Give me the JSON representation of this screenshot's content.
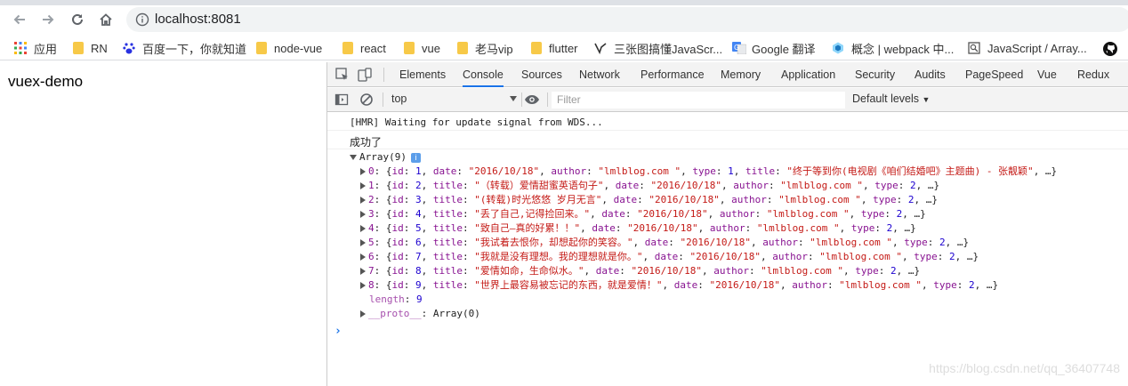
{
  "browser": {
    "url": "localhost:8081"
  },
  "bookmarks": [
    {
      "label": "应用",
      "icon": "apps-grid-icon"
    },
    {
      "label": "RN",
      "icon": "folder-icon"
    },
    {
      "label": "百度一下，你就知道",
      "icon": "baidu-paw-icon"
    },
    {
      "label": "node-vue",
      "icon": "folder-icon"
    },
    {
      "label": "react",
      "icon": "folder-icon"
    },
    {
      "label": "vue",
      "icon": "folder-icon"
    },
    {
      "label": "老马vip",
      "icon": "folder-icon"
    },
    {
      "label": "flutter",
      "icon": "folder-icon"
    },
    {
      "label": "三张图搞懂JavaScr...",
      "icon": "link-favicon-icon"
    },
    {
      "label": "Google 翻译",
      "icon": "google-translate-icon"
    },
    {
      "label": "概念 | webpack 中...",
      "icon": "webpack-icon"
    },
    {
      "label": "JavaScript / Array...",
      "icon": "page-icon"
    },
    {
      "label": "",
      "icon": "github-icon"
    }
  ],
  "page": {
    "title": "vuex-demo"
  },
  "devtools": {
    "tabs": [
      "Elements",
      "Console",
      "Sources",
      "Network",
      "Performance",
      "Memory",
      "Application",
      "Security",
      "Audits",
      "PageSpeed",
      "Vue",
      "Redux"
    ],
    "active_tab": "Console",
    "context": "top",
    "filter_placeholder": "Filter",
    "levels": "Default levels"
  },
  "console": {
    "hmr": "[HMR] Waiting for update signal from WDS...",
    "success": "成功了",
    "array_header": "Array(9)",
    "items": [
      {
        "idx": "0",
        "id": "1",
        "first_key": "date",
        "first_val": "\"2016/10/18\"",
        "second_key": "author",
        "second_val": "\"lmlblog.com \"",
        "third_key": "type",
        "third_val": "1",
        "fourth_key": "title",
        "fourth_val": "\"终于等到你(电视剧《咱们结婚吧》主题曲) - 张靓颖\"",
        "tail": ", …}"
      },
      {
        "idx": "1",
        "id": "2",
        "first_key": "title",
        "first_val": "\"（转载）爱情甜蜜英语句子\"",
        "second_key": "date",
        "second_val": "\"2016/10/18\"",
        "third_key": "author",
        "third_val": "\"lmlblog.com \"",
        "fourth_key": "type",
        "fourth_val": "2",
        "tail": ", …}"
      },
      {
        "idx": "2",
        "id": "3",
        "first_key": "title",
        "first_val": "\"(转载)时光悠悠 岁月无言\"",
        "second_key": "date",
        "second_val": "\"2016/10/18\"",
        "third_key": "author",
        "third_val": "\"lmlblog.com \"",
        "fourth_key": "type",
        "fourth_val": "2",
        "tail": ", …}"
      },
      {
        "idx": "3",
        "id": "4",
        "first_key": "title",
        "first_val": "\"丢了自己,记得捡回来。\"",
        "second_key": "date",
        "second_val": "\"2016/10/18\"",
        "third_key": "author",
        "third_val": "\"lmlblog.com \"",
        "fourth_key": "type",
        "fourth_val": "2",
        "tail": ", …}"
      },
      {
        "idx": "4",
        "id": "5",
        "first_key": "title",
        "first_val": "\"致自己—真的好累！！\"",
        "second_key": "date",
        "second_val": "\"2016/10/18\"",
        "third_key": "author",
        "third_val": "\"lmlblog.com \"",
        "fourth_key": "type",
        "fourth_val": "2",
        "tail": ", …}"
      },
      {
        "idx": "5",
        "id": "6",
        "first_key": "title",
        "first_val": "\"我试着去恨你，却想起你的笑容。\"",
        "second_key": "date",
        "second_val": "\"2016/10/18\"",
        "third_key": "author",
        "third_val": "\"lmlblog.com \"",
        "fourth_key": "type",
        "fourth_val": "2",
        "tail": ", …}"
      },
      {
        "idx": "6",
        "id": "7",
        "first_key": "title",
        "first_val": "\"我就是没有理想。我的理想就是你。\"",
        "second_key": "date",
        "second_val": "\"2016/10/18\"",
        "third_key": "author",
        "third_val": "\"lmlblog.com \"",
        "fourth_key": "type",
        "fourth_val": "2",
        "tail": ", …}"
      },
      {
        "idx": "7",
        "id": "8",
        "first_key": "title",
        "first_val": "\"爱情如命，生命似水。\"",
        "second_key": "date",
        "second_val": "\"2016/10/18\"",
        "third_key": "author",
        "third_val": "\"lmlblog.com \"",
        "fourth_key": "type",
        "fourth_val": "2",
        "tail": ", …}"
      },
      {
        "idx": "8",
        "id": "9",
        "first_key": "title",
        "first_val": "\"世界上最容易被忘记的东西，就是爱情！\"",
        "second_key": "date",
        "second_val": "\"2016/10/18\"",
        "third_key": "author",
        "third_val": "\"lmlblog.com \"",
        "fourth_key": "type",
        "fourth_val": "2",
        "tail": ", …}"
      }
    ],
    "length_key": "length",
    "length_val": "9",
    "proto_key": "__proto__",
    "proto_val": "Array(0)"
  },
  "watermark": "https://blog.csdn.net/qq_36407748"
}
